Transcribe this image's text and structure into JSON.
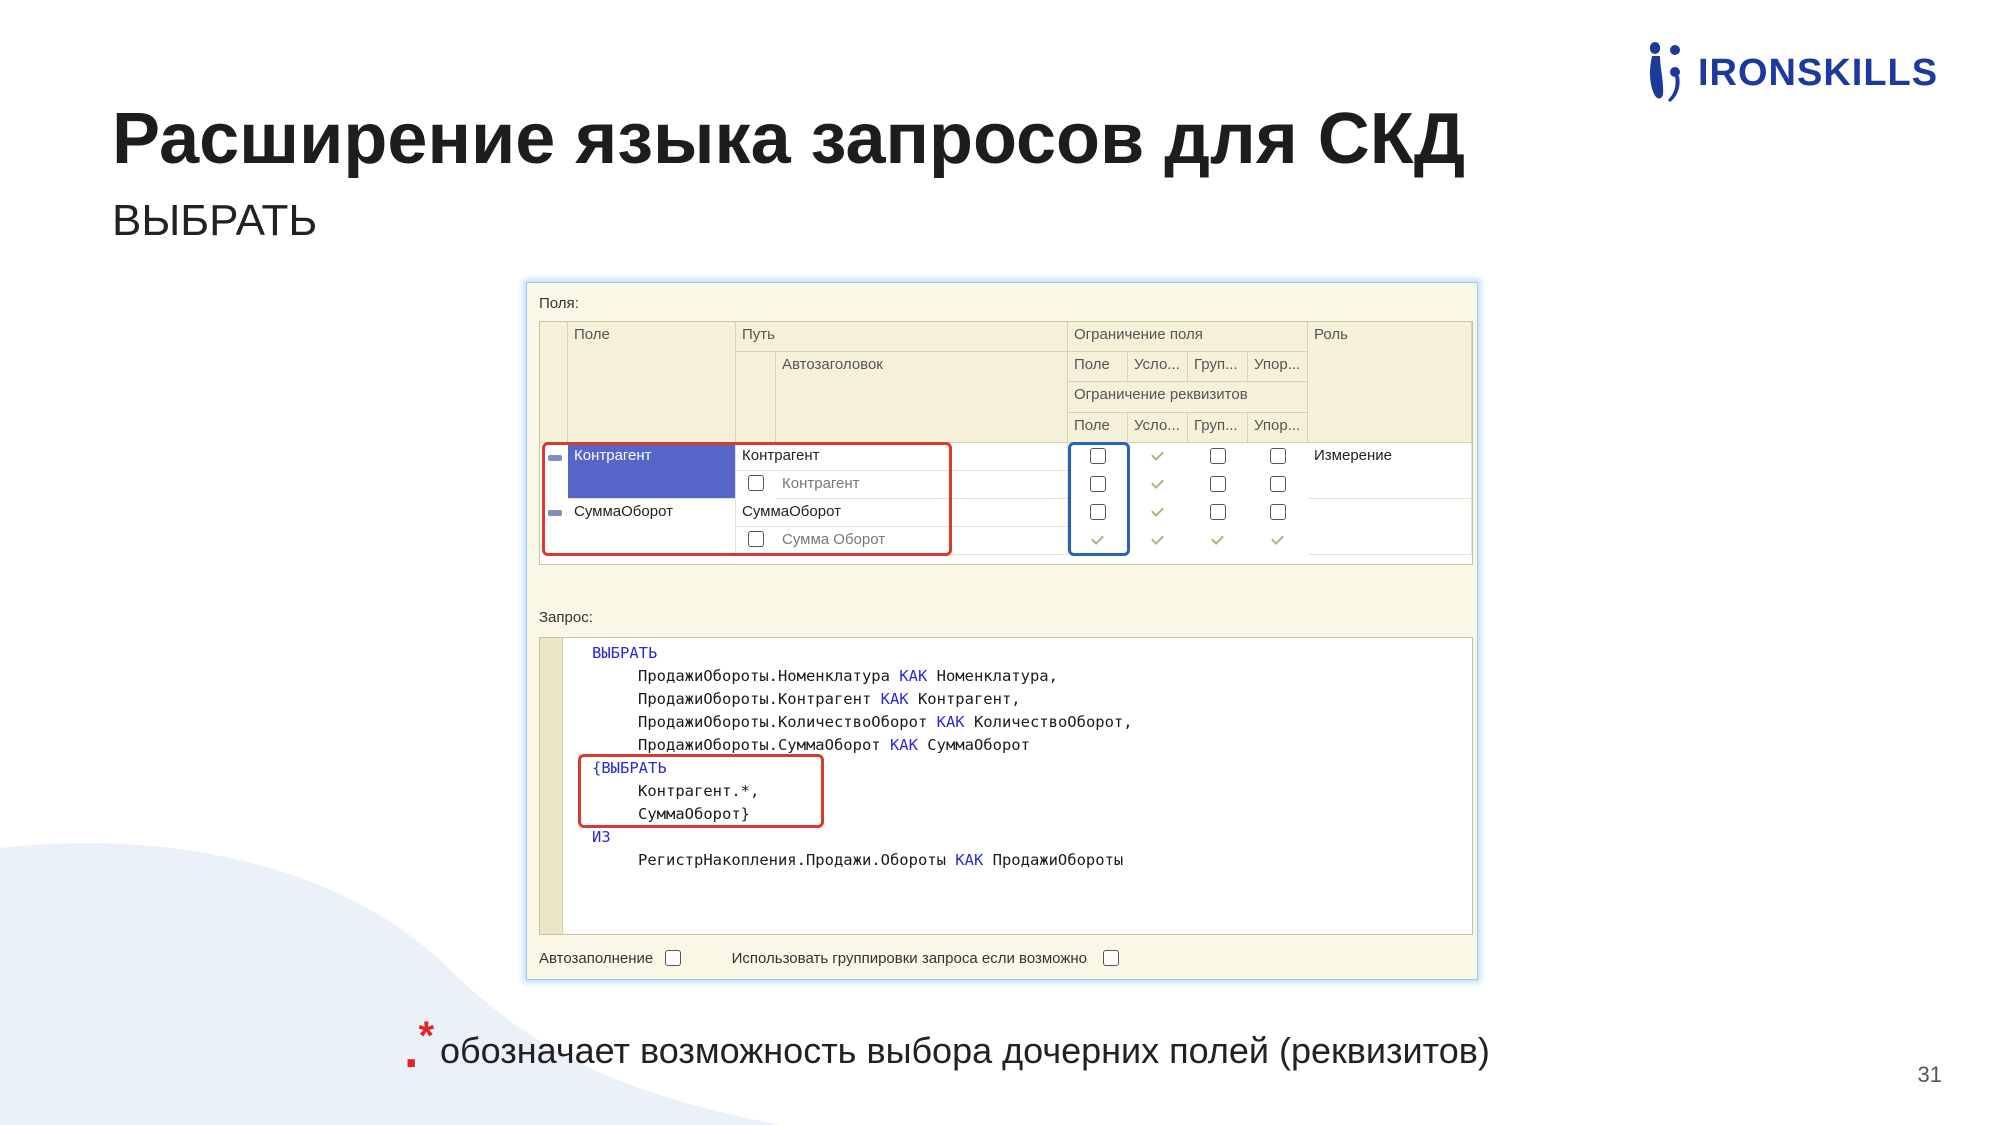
{
  "slide": {
    "title": "Расширение языка запросов для СКД",
    "subtitle": "ВЫБРАТЬ",
    "page_number": "31",
    "logo_text": "IRONSKILLS",
    "footnote_dot": ".",
    "footnote_star": "*",
    "footnote_text": "обозначает возможность выбора дочерних полей (реквизитов)"
  },
  "colors": {
    "brand": "#1b3a9b",
    "accent_red": "#d93a2e",
    "accent_blue": "#2a62b8",
    "selection": "#5565c8"
  },
  "window": {
    "fields_label": "Поля:",
    "headers": {
      "field": "Поле",
      "path": "Путь",
      "autotitle": "Автозаголовок",
      "field_restriction": "Ограничение поля",
      "attr_restriction": "Ограничение реквизитов",
      "role": "Роль",
      "sub": [
        "Поле",
        "Усло...",
        "Груп...",
        "Упор..."
      ]
    },
    "rows": [
      {
        "field": "Контрагент",
        "path": "Контрагент",
        "autotitle": "Контрагент",
        "role": "Измерение",
        "field_checks": [
          "unchecked",
          "checked-disabled",
          "unchecked",
          "unchecked"
        ],
        "attr_checks": [
          "unchecked",
          "checked-disabled",
          "unchecked",
          "unchecked"
        ],
        "autotitle_checked": false
      },
      {
        "field": "СуммаОборот",
        "path": "СуммаОборот",
        "autotitle": "Сумма Оборот",
        "role": "",
        "field_checks": [
          "unchecked",
          "checked-disabled",
          "unchecked",
          "unchecked"
        ],
        "attr_checks": [
          "checked-disabled",
          "checked-disabled",
          "checked-disabled",
          "checked-disabled"
        ],
        "autotitle_checked": false
      }
    ],
    "query_label": "Запрос:",
    "query": {
      "l1_kw": "ВЫБРАТЬ",
      "l2_a": "ПродажиОбороты.Номенклатура ",
      "l2_kw": "КАК",
      "l2_b": " Номенклатура,",
      "l3_a": "ПродажиОбороты.Контрагент ",
      "l3_kw": "КАК",
      "l3_b": " Контрагент,",
      "l4_a": "ПродажиОбороты.КоличествоОборот ",
      "l4_kw": "КАК",
      "l4_b": " КоличествоОборот,",
      "l5_a": "ПродажиОбороты.СуммаОборот ",
      "l5_kw": "КАК",
      "l5_b": " СуммаОборот",
      "l6_kw": "{ВЫБРАТЬ",
      "l7": "Контрагент.*,",
      "l8": "СуммаОборот}",
      "l9_kw": "ИЗ",
      "l10_a": "РегистрНакопления.Продажи.Обороты ",
      "l10_kw": "КАК",
      "l10_b": " ПродажиОбороты"
    },
    "autofill_label": "Автозаполнение",
    "grouping_label": "Использовать группировки запроса если возможно"
  }
}
